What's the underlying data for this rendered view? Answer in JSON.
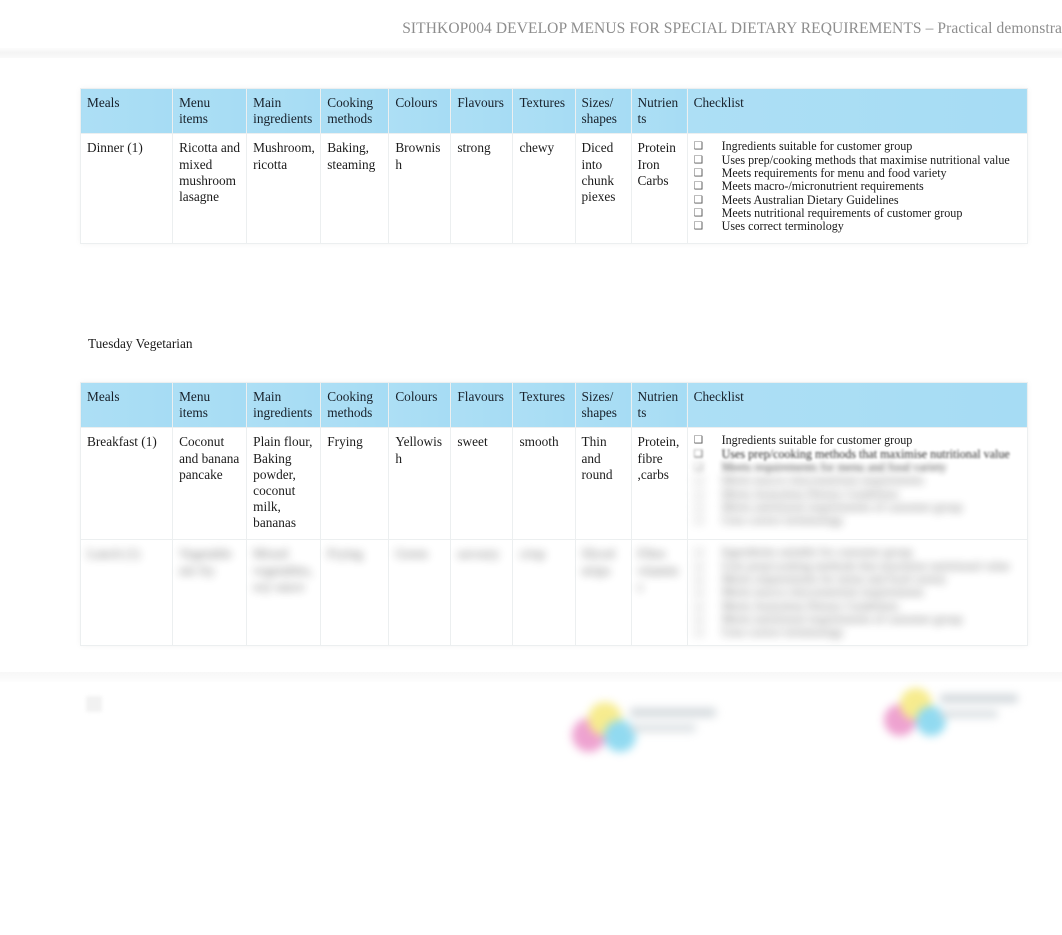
{
  "document": {
    "header_title": "SITHKOP004 DEVELOP MENUS FOR SPECIAL DIETARY REQUIREMENTS – Practical demonstra",
    "section_caption": "Tuesday Vegetarian"
  },
  "theme": {
    "header_fill": "#9fdcf4",
    "border": "#eceff0",
    "text": "#1b1b1b",
    "header_text_muted": "#8d8d8d"
  },
  "icons": {
    "checkbox": "❑"
  },
  "columns": [
    "Meals",
    "Menu items",
    "Main ingredients",
    "Cooking methods",
    "Colours",
    "Flavours",
    "Textures",
    "Sizes/ shapes",
    "Nutrients",
    "Checklist"
  ],
  "checklist_items": [
    "Ingredients suitable for customer group",
    "Uses prep/cooking methods that maximise nutritional value",
    "Meets requirements for menu and food variety",
    "Meets macro-/micronutrient requirements",
    "Meets Australian Dietary Guidelines",
    "Meets nutritional requirements of customer group",
    "Uses correct terminology"
  ],
  "table_one": {
    "rows": [
      {
        "meals": "Dinner (1)",
        "menu_items": "Ricotta and mixed mushroom lasagne",
        "main_ingredients": "Mushroom, ricotta",
        "cooking_methods": "Baking, steaming",
        "colours": "Brownish",
        "flavours": "strong",
        "textures": "chewy",
        "sizes_shapes": "Diced into chunk piexes",
        "nutrients": "Protein Iron Carbs"
      }
    ]
  },
  "table_two": {
    "rows": [
      {
        "meals": "Breakfast (1)",
        "menu_items": "Coconut and banana pancake",
        "main_ingredients": "Plain flour, Baking powder, coconut milk, bananas",
        "cooking_methods": "Frying",
        "colours": "Yellowish",
        "flavours": "sweet",
        "textures": "smooth",
        "sizes_shapes": "Thin and round",
        "nutrients": "Protein, fibre ,carbs"
      },
      {
        "meals": "Lunch (1)",
        "menu_items": "Vegetable stir fry",
        "main_ingredients": "Mixed vegetables, soy sauce",
        "cooking_methods": "Frying",
        "colours": "Green",
        "flavours": "savoury",
        "textures": "crisp",
        "sizes_shapes": "Sliced strips",
        "nutrients": "Fibre vitamins"
      }
    ]
  }
}
